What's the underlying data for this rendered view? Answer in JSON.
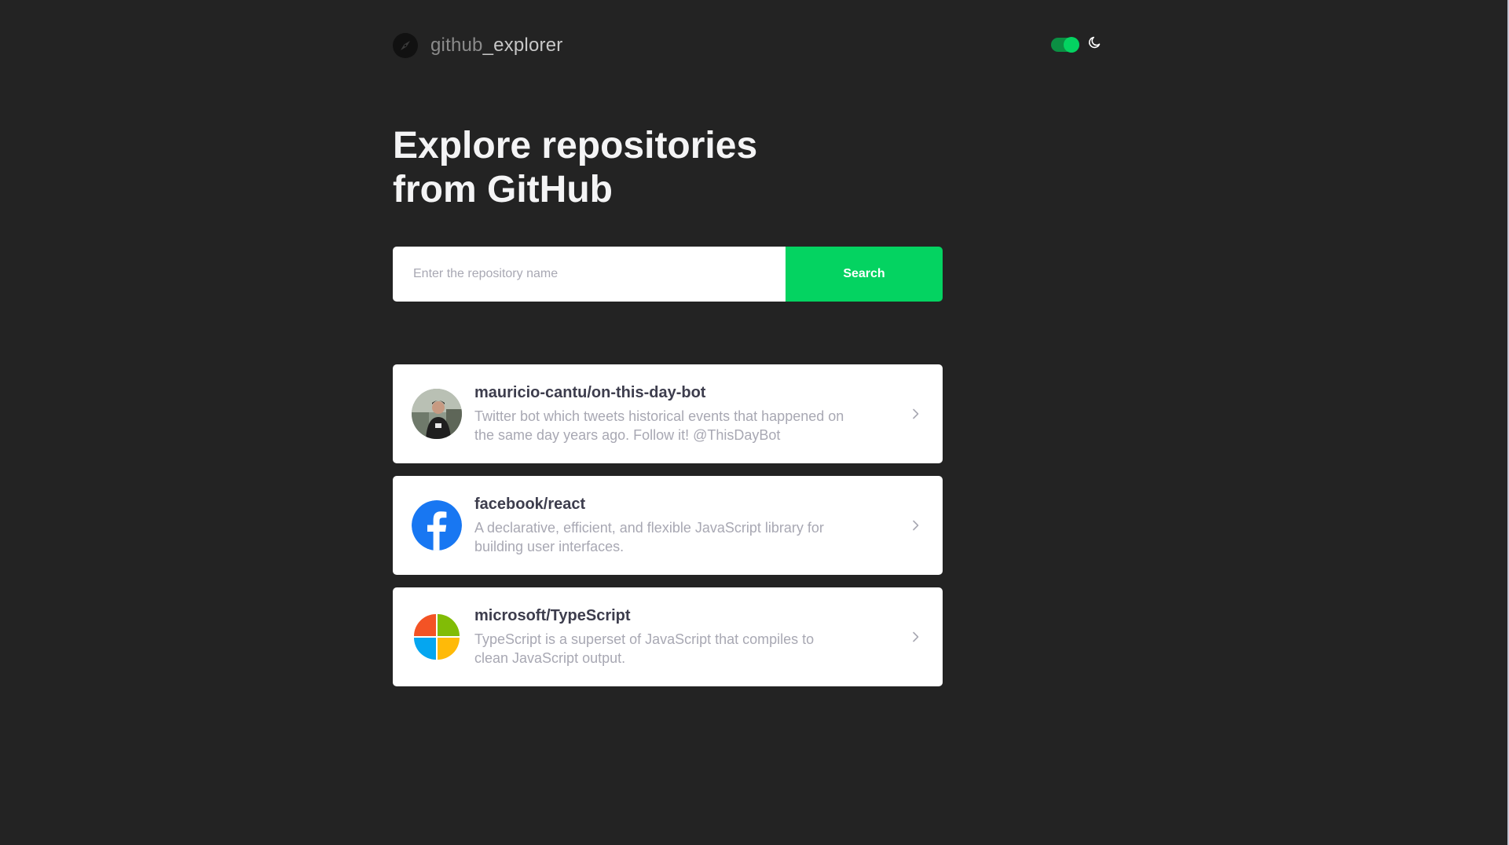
{
  "header": {
    "logo_prefix": "github",
    "logo_suffix": "_explorer",
    "theme_toggle_state": "on",
    "theme_icon": "moon-icon"
  },
  "hero": {
    "title_line1": "Explore repositories",
    "title_line2": "from GitHub"
  },
  "search": {
    "placeholder": "Enter the repository name",
    "value": "",
    "button_label": "Search"
  },
  "repositories": [
    {
      "full_name": "mauricio-cantu/on-this-day-bot",
      "description": "Twitter bot which tweets historical events that happened on the same day years ago. Follow it! @ThisDayBot",
      "avatar": "user-photo-avatar"
    },
    {
      "full_name": "facebook/react",
      "description": "A declarative, efficient, and flexible JavaScript library for building user interfaces.",
      "avatar": "facebook-logo-avatar"
    },
    {
      "full_name": "microsoft/TypeScript",
      "description": "TypeScript is a superset of JavaScript that compiles to clean JavaScript output.",
      "avatar": "microsoft-logo-avatar"
    }
  ],
  "colors": {
    "background": "#232323",
    "accent": "#04d361",
    "card": "#ffffff",
    "title_text": "#f4f4f5",
    "repo_name": "#3d3d4d",
    "repo_desc": "#a8a8b3"
  }
}
